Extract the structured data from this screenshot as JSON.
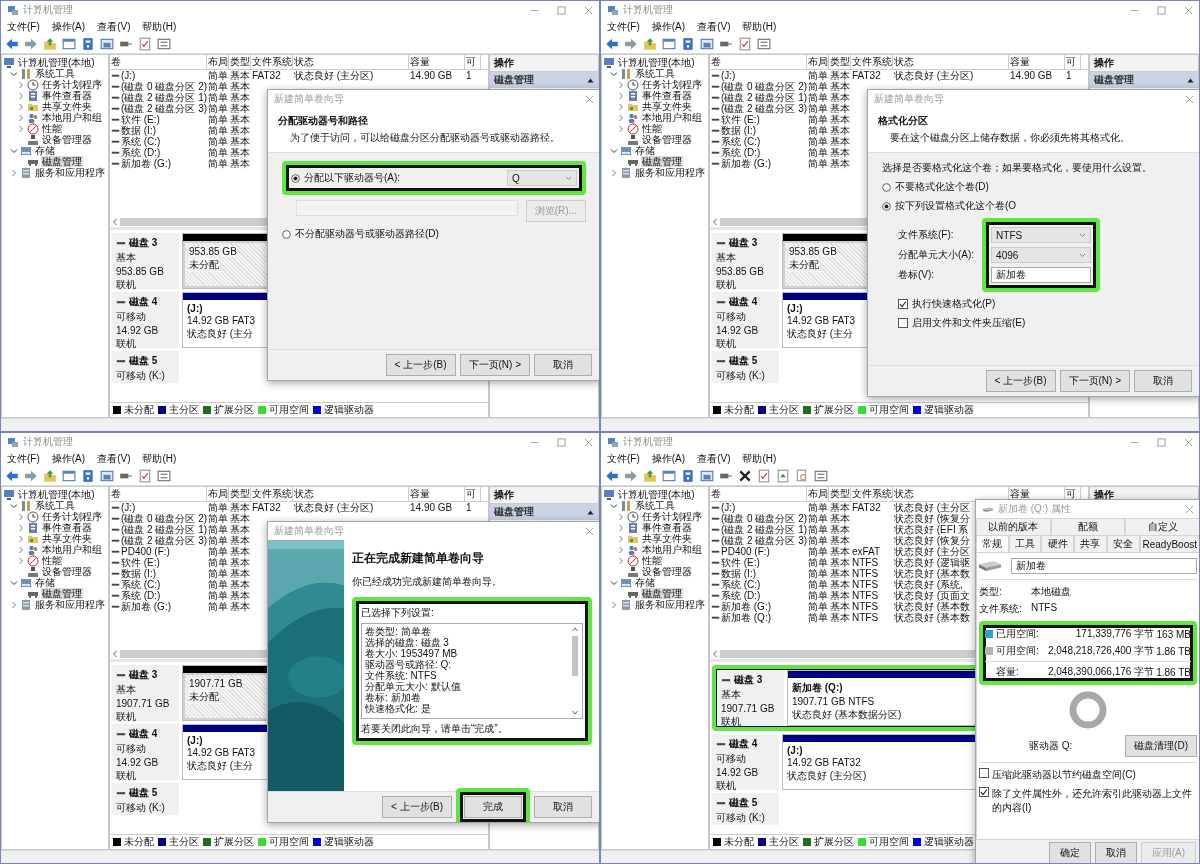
{
  "panels": [
    {
      "window_title": "计算机管理",
      "menu": [
        "文件(F)",
        "操作(A)",
        "查看(V)",
        "帮助(H)"
      ],
      "toolbar": {
        "extra_tools": false
      },
      "tree": [
        {
          "label": "计算机管理(本地)",
          "kind": "computer",
          "selected": false,
          "children": [
            {
              "label": "系统工具",
              "kind": "tools",
              "expanded": true,
              "selected": false,
              "children": [
                {
                  "label": "任务计划程序",
                  "kind": "clock",
                  "expanded": false,
                  "selected": false
                },
                {
                  "label": "事件查看器",
                  "kind": "log",
                  "expanded": false,
                  "selected": false
                },
                {
                  "label": "共享文件夹",
                  "kind": "folder",
                  "expanded": false,
                  "selected": false
                },
                {
                  "label": "本地用户和组",
                  "kind": "users",
                  "expanded": false,
                  "selected": false
                },
                {
                  "label": "性能",
                  "kind": "gauge",
                  "expanded": false,
                  "selected": false
                },
                {
                  "label": "设备管理器",
                  "kind": "device",
                  "selected": false
                }
              ]
            },
            {
              "label": "存储",
              "kind": "storage",
              "expanded": true,
              "selected": false,
              "children": [
                {
                  "label": "磁盘管理",
                  "kind": "disk",
                  "selected": true
                }
              ]
            },
            {
              "label": "服务和应用程序",
              "kind": "server",
              "expanded": false,
              "selected": false
            }
          ]
        }
      ],
      "volumes": {
        "columns": [
          "卷",
          "布局",
          "类型",
          "文件系统",
          "状态",
          "容量",
          "可"
        ],
        "rows": [
          [
            "(J:)",
            "简单",
            "基本",
            "FAT32",
            "状态良好 (主分区)",
            "14.90 GB",
            "1"
          ],
          [
            "(磁盘 0 磁盘分区 2)",
            "简单",
            "基本"
          ],
          [
            "(磁盘 2 磁盘分区 1)",
            "简单",
            "基本"
          ],
          [
            "(磁盘 2 磁盘分区 3)",
            "简单",
            "基本"
          ],
          [
            "软件 (E:)",
            "简单",
            "基本"
          ],
          [
            "数据 (I:)",
            "简单",
            "基本"
          ],
          [
            "系统 (C:)",
            "简单",
            "基本"
          ],
          [
            "系统 (D:)",
            "简单",
            "基本"
          ],
          [
            "新加卷 (G:)",
            "简单",
            "基本"
          ]
        ]
      },
      "disks": [
        {
          "name": "磁盘 3",
          "details": [
            "基本",
            "953.85 GB",
            "联机"
          ],
          "partition": {
            "kind": "unallocated",
            "lines": [
              "953.85 GB",
              "未分配"
            ]
          }
        },
        {
          "name": "磁盘 4",
          "details": [
            "可移动",
            "14.92 GB",
            "联机"
          ],
          "partition": {
            "kind": "primary",
            "lines": [
              "(J:)",
              "14.92 GB FAT3",
              "状态良好 (主分"
            ]
          }
        },
        {
          "name": "磁盘 5",
          "details": [
            "可移动 (K:)"
          ]
        }
      ],
      "legend": [
        {
          "label": "未分配",
          "color": "#000000"
        },
        {
          "label": "主分区",
          "color": "#000080"
        },
        {
          "label": "扩展分区",
          "color": "#1e6e1e"
        },
        {
          "label": "可用空间",
          "color": "#33dd33"
        },
        {
          "label": "逻辑驱动器",
          "color": "#0000dd"
        }
      ],
      "actions": {
        "title": "操作",
        "items": [
          {
            "label": "磁盘管理"
          }
        ]
      },
      "dialog": {
        "kind": "wizard_page",
        "title": "新建简单卷向导",
        "heading": "分配驱动器号和路径",
        "subheading": "为了便于访问，可以给磁盘分区分配驱动器号或驱动器路径。",
        "body": [
          {
            "kind": "radio_dropdown",
            "label": "分配以下驱动器号(A):",
            "selected": true,
            "value": "Q",
            "highlighted": true
          },
          {
            "kind": "path_field",
            "button": "浏览(R)...",
            "disabled": true
          },
          {
            "kind": "radio",
            "label": "不分配驱动器号或驱动器路径(D)",
            "selected": false
          }
        ],
        "buttons": [
          {
            "label": "< 上一步(B)"
          },
          {
            "label": "下一页(N) >"
          },
          {
            "label": "取消"
          }
        ]
      }
    },
    {
      "window_title": "计算机管理",
      "menu": [
        "文件(F)",
        "操作(A)",
        "查看(V)",
        "帮助(H)"
      ],
      "toolbar": {
        "extra_tools": false
      },
      "tree": [
        {
          "label": "计算机管理(本地)",
          "kind": "computer",
          "selected": false,
          "children": [
            {
              "label": "系统工具",
              "kind": "tools",
              "expanded": true,
              "selected": false,
              "children": [
                {
                  "label": "任务计划程序",
                  "kind": "clock",
                  "expanded": false,
                  "selected": false
                },
                {
                  "label": "事件查看器",
                  "kind": "log",
                  "expanded": false,
                  "selected": false
                },
                {
                  "label": "共享文件夹",
                  "kind": "folder",
                  "expanded": false,
                  "selected": false
                },
                {
                  "label": "本地用户和组",
                  "kind": "users",
                  "expanded": false,
                  "selected": false
                },
                {
                  "label": "性能",
                  "kind": "gauge",
                  "expanded": false,
                  "selected": false
                },
                {
                  "label": "设备管理器",
                  "kind": "device",
                  "selected": false
                }
              ]
            },
            {
              "label": "存储",
              "kind": "storage",
              "expanded": true,
              "selected": false,
              "children": [
                {
                  "label": "磁盘管理",
                  "kind": "disk",
                  "selected": true
                }
              ]
            },
            {
              "label": "服务和应用程序",
              "kind": "server",
              "expanded": false,
              "selected": false
            }
          ]
        }
      ],
      "volumes": {
        "columns": [
          "卷",
          "布局",
          "类型",
          "文件系统",
          "状态",
          "容量",
          "可"
        ],
        "rows": [
          [
            "(J:)",
            "简单",
            "基本",
            "FAT32",
            "状态良好 (主分区)",
            "14.90 GB",
            "1"
          ],
          [
            "(磁盘 0 磁盘分区 2)",
            "简单",
            "基本"
          ],
          [
            "(磁盘 2 磁盘分区 1)",
            "简单",
            "基本"
          ],
          [
            "(磁盘 2 磁盘分区 3)",
            "简单",
            "基本"
          ],
          [
            "软件 (E:)",
            "简单",
            "基本"
          ],
          [
            "数据 (I:)",
            "简单",
            "基本"
          ],
          [
            "系统 (C:)",
            "简单",
            "基本"
          ],
          [
            "系统 (D:)",
            "简单",
            "基本"
          ],
          [
            "新加卷 (G:)",
            "简单",
            "基本"
          ]
        ]
      },
      "disks": [
        {
          "name": "磁盘 3",
          "details": [
            "基本",
            "953.85 GB",
            "联机"
          ],
          "partition": {
            "kind": "unallocated",
            "lines": [
              "953.85 GB",
              "未分配"
            ]
          }
        },
        {
          "name": "磁盘 4",
          "details": [
            "可移动",
            "14.92 GB",
            "联机"
          ],
          "partition": {
            "kind": "primary",
            "lines": [
              "(J:)",
              "14.92 GB FAT3",
              "状态良好 (主分"
            ]
          }
        },
        {
          "name": "磁盘 5",
          "details": [
            "可移动 (K:)"
          ]
        }
      ],
      "legend": [
        {
          "label": "未分配",
          "color": "#000000"
        },
        {
          "label": "主分区",
          "color": "#000080"
        },
        {
          "label": "扩展分区",
          "color": "#1e6e1e"
        },
        {
          "label": "可用空间",
          "color": "#33dd33"
        },
        {
          "label": "逻辑驱动器",
          "color": "#0000dd"
        }
      ],
      "actions": {
        "title": "操作",
        "items": [
          {
            "label": "磁盘管理"
          }
        ]
      },
      "dialog": {
        "kind": "wizard_page",
        "title": "新建简单卷向导",
        "heading": "格式化分区",
        "subheading": "要在这个磁盘分区上储存数据，你必须先将其格式化。",
        "body": [
          {
            "kind": "text",
            "text": "选择是否要格式化这个卷；如果要格式化，要使用什么设置。"
          },
          {
            "kind": "radio",
            "label": "不要格式化这个卷(D)",
            "selected": false
          },
          {
            "kind": "radio",
            "label": "按下列设置格式化这个卷(O",
            "selected": true
          },
          {
            "kind": "form",
            "highlighted": true,
            "fields": [
              {
                "label": "文件系统(F):",
                "kind": "dropdown",
                "value": "NTFS"
              },
              {
                "label": "分配单元大小(A):",
                "kind": "dropdown",
                "value": "4096"
              },
              {
                "label": "卷标(V):",
                "kind": "input",
                "value": "新加卷"
              }
            ]
          },
          {
            "kind": "checkbox",
            "label": "执行快速格式化(P)",
            "checked": true
          },
          {
            "kind": "checkbox",
            "label": "启用文件和文件夹压缩(E)",
            "checked": false
          }
        ],
        "buttons": [
          {
            "label": "< 上一步(B)"
          },
          {
            "label": "下一页(N) >"
          },
          {
            "label": "取消"
          }
        ]
      }
    },
    {
      "window_title": "计算机管理",
      "menu": [
        "文件(F)",
        "操作(A)",
        "查看(V)",
        "帮助(H)"
      ],
      "toolbar": {
        "extra_tools": false
      },
      "tree": [
        {
          "label": "计算机管理(本地)",
          "kind": "computer",
          "selected": false,
          "children": [
            {
              "label": "系统工具",
              "kind": "tools",
              "expanded": true,
              "selected": false,
              "children": [
                {
                  "label": "任务计划程序",
                  "kind": "clock",
                  "expanded": false,
                  "selected": false
                },
                {
                  "label": "事件查看器",
                  "kind": "log",
                  "expanded": false,
                  "selected": false
                },
                {
                  "label": "共享文件夹",
                  "kind": "folder",
                  "expanded": false,
                  "selected": false
                },
                {
                  "label": "本地用户和组",
                  "kind": "users",
                  "expanded": false,
                  "selected": false
                },
                {
                  "label": "性能",
                  "kind": "gauge",
                  "expanded": false,
                  "selected": false
                },
                {
                  "label": "设备管理器",
                  "kind": "device",
                  "selected": false
                }
              ]
            },
            {
              "label": "存储",
              "kind": "storage",
              "expanded": true,
              "selected": false,
              "children": [
                {
                  "label": "磁盘管理",
                  "kind": "disk",
                  "selected": true
                }
              ]
            },
            {
              "label": "服务和应用程序",
              "kind": "server",
              "expanded": false,
              "selected": false
            }
          ]
        }
      ],
      "volumes": {
        "columns": [
          "卷",
          "布局",
          "类型",
          "文件系统",
          "状态",
          "容量",
          "可"
        ],
        "rows": [
          [
            "(J:)",
            "简单",
            "基本",
            "FAT32",
            "状态良好 (主分区)",
            "14.90 GB",
            "1"
          ],
          [
            "(磁盘 0 磁盘分区 2)",
            "简单",
            "基本"
          ],
          [
            "(磁盘 2 磁盘分区 1)",
            "简单",
            "基本"
          ],
          [
            "(磁盘 2 磁盘分区 3)",
            "简单",
            "基本"
          ],
          [
            "PD400 (F:)",
            "简单",
            "基本"
          ],
          [
            "软件 (E:)",
            "简单",
            "基本"
          ],
          [
            "数据 (I:)",
            "简单",
            "基本"
          ],
          [
            "系统 (C:)",
            "简单",
            "基本"
          ],
          [
            "系统 (D:)",
            "简单",
            "基本"
          ],
          [
            "新加卷 (G:)",
            "简单",
            "基本"
          ]
        ]
      },
      "disks": [
        {
          "name": "磁盘 3",
          "details": [
            "基本",
            "1907.71 GB",
            "联机"
          ],
          "partition": {
            "kind": "unallocated",
            "lines": [
              "1907.71 GB",
              "未分配"
            ]
          }
        },
        {
          "name": "磁盘 4",
          "details": [
            "可移动",
            "14.92 GB",
            "联机"
          ],
          "partition": {
            "kind": "primary",
            "lines": [
              "(J:)",
              "14.92 GB FAT3",
              "状态良好 (主分"
            ]
          }
        },
        {
          "name": "磁盘 5",
          "details": [
            "可移动 (K:)"
          ]
        }
      ],
      "legend": [
        {
          "label": "未分配",
          "color": "#000000"
        },
        {
          "label": "主分区",
          "color": "#000080"
        },
        {
          "label": "扩展分区",
          "color": "#1e6e1e"
        },
        {
          "label": "可用空间",
          "color": "#33dd33"
        },
        {
          "label": "逻辑驱动器",
          "color": "#0000dd"
        }
      ],
      "actions": {
        "title": "操作",
        "items": [
          {
            "label": "磁盘管理"
          }
        ]
      },
      "dialog": {
        "kind": "wizard_finish",
        "title": "新建简单卷向导",
        "heading": "正在完成新建简单卷向导",
        "text": "你已经成功完成新建简单卷向导。",
        "settings": {
          "label": "已选择下列设置:",
          "highlighted": true,
          "lines": [
            "卷类型: 简单卷",
            "选择的磁盘: 磁盘 3",
            "卷大小: 1953497 MB",
            "驱动器号或路径: Q:",
            "文件系统: NTFS",
            "分配单元大小: 默认值",
            "卷标: 新加卷",
            "快速格式化: 是"
          ],
          "footer": "若要关闭此向导，请单击“完成”。"
        },
        "buttons": [
          {
            "label": "< 上一步(B)"
          },
          {
            "label": "完成",
            "highlighted": true
          },
          {
            "label": "取消"
          }
        ]
      }
    },
    {
      "window_title": "计算机管理",
      "menu": [
        "文件(F)",
        "操作(A)",
        "查看(V)",
        "帮助(H)"
      ],
      "toolbar": {
        "extra_tools": true
      },
      "tree": [
        {
          "label": "计算机管理(本地)",
          "kind": "computer",
          "selected": false,
          "children": [
            {
              "label": "系统工具",
              "kind": "tools",
              "expanded": true,
              "selected": false,
              "children": [
                {
                  "label": "任务计划程序",
                  "kind": "clock",
                  "expanded": false,
                  "selected": false
                },
                {
                  "label": "事件查看器",
                  "kind": "log",
                  "expanded": false,
                  "selected": false
                },
                {
                  "label": "共享文件夹",
                  "kind": "folder",
                  "expanded": false,
                  "selected": false
                },
                {
                  "label": "本地用户和组",
                  "kind": "users",
                  "expanded": false,
                  "selected": false
                },
                {
                  "label": "性能",
                  "kind": "gauge",
                  "expanded": false,
                  "selected": false
                },
                {
                  "label": "设备管理器",
                  "kind": "device",
                  "selected": false
                }
              ]
            },
            {
              "label": "存储",
              "kind": "storage",
              "expanded": true,
              "selected": false,
              "children": [
                {
                  "label": "磁盘管理",
                  "kind": "disk",
                  "selected": true
                }
              ]
            },
            {
              "label": "服务和应用程序",
              "kind": "server",
              "expanded": false,
              "selected": false
            }
          ]
        }
      ],
      "volumes": {
        "columns": [
          "卷",
          "布局",
          "类型",
          "文件系统",
          "状态",
          "容量",
          "可"
        ],
        "rows": [
          [
            "(J:)",
            "简单",
            "基本",
            "FAT32",
            "状态良好 (主分区"
          ],
          [
            "(磁盘 0 磁盘分区 2)",
            "简单",
            "基本",
            null,
            "状态良好 (恢复分"
          ],
          [
            "(磁盘 2 磁盘分区 1)",
            "简单",
            "基本",
            null,
            "状态良好 (EFI 系"
          ],
          [
            "(磁盘 2 磁盘分区 3)",
            "简单",
            "基本",
            null,
            "状态良好 (恢复分"
          ],
          [
            "PD400 (F:)",
            "简单",
            "基本",
            "exFAT",
            "状态良好 (主分区"
          ],
          [
            "软件 (E:)",
            "简单",
            "基本",
            "NTFS",
            "状态良好 (逻辑驱"
          ],
          [
            "数据 (I:)",
            "简单",
            "基本",
            "NTFS",
            "状态良好 (基本数"
          ],
          [
            "系统 (C:)",
            "简单",
            "基本",
            "NTFS",
            "状态良好 (系统,"
          ],
          [
            "系统 (D:)",
            "简单",
            "基本",
            "NTFS",
            "状态良好 (页面文"
          ],
          [
            "新加卷 (G:)",
            "简单",
            "基本",
            "NTFS",
            "状态良好 (基本数"
          ],
          [
            "新加卷 (Q:)",
            "简单",
            "基本",
            "NTFS",
            "状态良好 (基本数"
          ]
        ]
      },
      "disks": [
        {
          "name": "磁盘 3",
          "details": [
            "基本",
            "1907.71 GB",
            "联机"
          ],
          "highlighted": true,
          "partition": {
            "kind": "primary",
            "lines": [
              "新加卷 (Q:)",
              "1907.71 GB NTFS",
              "状态良好 (基本数据分区)"
            ]
          }
        },
        {
          "name": "磁盘 4",
          "details": [
            "可移动",
            "14.92 GB",
            "联机"
          ],
          "partition": {
            "kind": "primary",
            "lines": [
              "(J:)",
              "14.92 GB FAT32",
              "状态良好 (主分区)"
            ]
          }
        },
        {
          "name": "磁盘 5",
          "details": [
            "可移动 (K:)"
          ]
        }
      ],
      "legend": [
        {
          "label": "未分配",
          "color": "#000000"
        },
        {
          "label": "主分区",
          "color": "#000080"
        },
        {
          "label": "扩展分区",
          "color": "#1e6e1e"
        },
        {
          "label": "可用空间",
          "color": "#33dd33"
        },
        {
          "label": "逻辑驱动器",
          "color": "#0000dd"
        }
      ],
      "actions": {
        "title": "操作"
      },
      "dialog": {
        "kind": "properties",
        "title": "新加卷 (Q:) 属性",
        "tabs_back": [
          {
            "label": "以前的版本",
            "selected": false
          },
          {
            "label": "配额",
            "selected": false
          },
          {
            "label": "自定义",
            "selected": false
          }
        ],
        "tabs": [
          {
            "label": "常规",
            "selected": true
          },
          {
            "label": "工具",
            "selected": false
          },
          {
            "label": "硬件",
            "selected": false
          },
          {
            "label": "共享",
            "selected": false
          },
          {
            "label": "安全",
            "selected": false
          },
          {
            "label": "ReadyBoost",
            "selected": false
          }
        ],
        "name": "新加卷",
        "info": [
          {
            "label": "类型:",
            "value": "本地磁盘"
          },
          {
            "label": "文件系统:",
            "value": "NTFS"
          }
        ],
        "usage": {
          "highlighted": true,
          "rows": [
            {
              "label": "已用空间:",
              "bytes": "171,339,776 字节",
              "size": "163 MB",
              "color": "#2a9fd8"
            },
            {
              "label": "可用空间:",
              "bytes": "2,048,218,726,400 字节",
              "size": "1.86 TB",
              "color": "#b4b4b4"
            }
          ],
          "total": {
            "label": "容量:",
            "bytes": "2,048,390,066,176 字节",
            "size": "1.86 TB"
          }
        },
        "drive_label": "驱动器 Q:",
        "cleanup_button": "磁盘清理(D)",
        "checkboxes": [
          {
            "label": "压缩此驱动器以节约磁盘空间(C)",
            "checked": false
          },
          {
            "label": "除了文件属性外，还允许索引此驱动器上文件的内容(I)",
            "checked": true
          }
        ],
        "buttons": [
          {
            "label": "确定"
          },
          {
            "label": "取消"
          },
          {
            "label": "应用(A)",
            "disabled": true
          }
        ]
      }
    }
  ]
}
